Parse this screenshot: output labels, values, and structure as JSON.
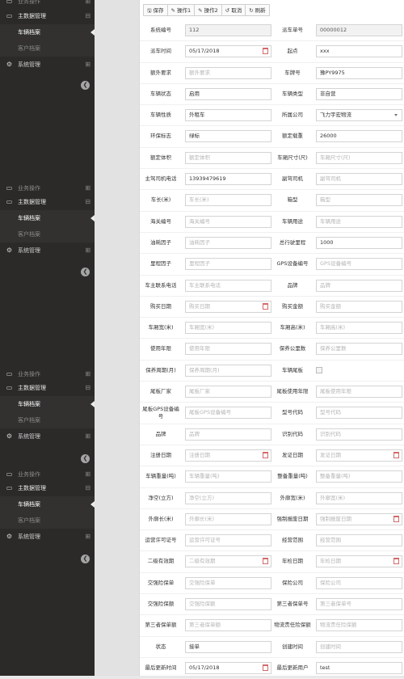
{
  "sidebar": {
    "ops_label": "业务操作",
    "master_label": "主数据管理",
    "vehicle_file": "车辆档案",
    "customer_file": "客户档案",
    "system_label": "系统管理"
  },
  "toolbar": {
    "save": "保存",
    "op1": "操作1",
    "op2": "操作2",
    "cancel": "取消",
    "refresh": "刷新"
  },
  "form": {
    "rows": [
      {
        "l": "系统编号",
        "lv": "112",
        "lt": "ro",
        "r": "派车单号",
        "rv": "00000012",
        "rt": "ro"
      },
      {
        "l": "派车时间",
        "lv": "05/17/2018",
        "lt": "date",
        "r": "起点",
        "rv": "xxx",
        "rt": "val"
      },
      {
        "l": "额外要求",
        "lv": "额外要求",
        "lt": "ph",
        "r": "车牌号",
        "rv": "豫PY9975",
        "rt": "val"
      },
      {
        "l": "车辆状态",
        "lv": "启用",
        "lt": "val",
        "r": "车辆类型",
        "rv": "非自营",
        "rt": "val"
      },
      {
        "l": "车辆性质",
        "lv": "外租车",
        "lt": "val",
        "r": "所属公司",
        "rv": "飞力宇宏物流",
        "rt": "select"
      },
      {
        "l": "环保标志",
        "lv": "绿标",
        "lt": "val",
        "r": "额定载重",
        "rv": "26000",
        "rt": "val"
      },
      {
        "l": "额定体积",
        "lv": "额定体积",
        "lt": "ph",
        "r": "车厢尺寸(尺)",
        "rv": "车厢尺寸(尺)",
        "rt": "ph"
      },
      {
        "l": "主驾司机电话",
        "lv": "13939479619",
        "lt": "val",
        "r": "副驾司机",
        "rv": "副驾司机",
        "rt": "ph"
      },
      {
        "l": "车长(米)",
        "lv": "车长(米)",
        "lt": "ph",
        "r": "箱型",
        "rv": "箱型",
        "rt": "ph"
      },
      {
        "l": "海关编号",
        "lv": "海关编号",
        "lt": "ph",
        "r": "车辆用途",
        "rv": "车辆用途",
        "rt": "ph"
      },
      {
        "l": "油耗因子",
        "lv": "油耗因子",
        "lt": "ph",
        "r": "总行驶里程",
        "rv": "1000",
        "rt": "val"
      },
      {
        "l": "里程因子",
        "lv": "里程因子",
        "lt": "ph",
        "r": "GPS设备编号",
        "rv": "GPS设备编号",
        "rt": "ph"
      },
      {
        "l": "车主联系电话",
        "lv": "车主联系电话",
        "lt": "ph",
        "r": "品牌",
        "rv": "品牌",
        "rt": "ph"
      },
      {
        "l": "购买日期",
        "lv": "购买日期",
        "lt": "phdate",
        "r": "购买金额",
        "rv": "购买金额",
        "rt": "ph"
      },
      {
        "l": "车厢宽(米)",
        "lv": "车厢宽(米)",
        "lt": "ph",
        "r": "车厢高(米)",
        "rv": "车厢高(米)",
        "rt": "ph"
      },
      {
        "l": "使用年限",
        "lv": "使用年限",
        "lt": "ph",
        "r": "保养公里数",
        "rv": "保养公里数",
        "rt": "ph"
      },
      {
        "l": "保养周期(月)",
        "lv": "保养周期(月)",
        "lt": "ph",
        "r": "车辆尾板",
        "rv": "",
        "rt": "check"
      },
      {
        "l": "尾板厂家",
        "lv": "尾板厂家",
        "lt": "ph",
        "r": "尾板使用年限",
        "rv": "尾板使用年限",
        "rt": "ph"
      },
      {
        "l": "尾板GPS设备编号",
        "lv": "尾板GPS设备编号",
        "lt": "ph",
        "r": "型号代码",
        "rv": "型号代码",
        "rt": "ph"
      },
      {
        "l": "品牌",
        "lv": "品牌",
        "lt": "ph",
        "r": "识别代码",
        "rv": "识别代码",
        "rt": "ph"
      },
      {
        "l": "注册日期",
        "lv": "注册日期",
        "lt": "phdate",
        "r": "发证日期",
        "rv": "发证日期",
        "rt": "phdate"
      },
      {
        "l": "车辆重量(吨)",
        "lv": "车辆重量(吨)",
        "lt": "ph",
        "r": "整备重量(吨)",
        "rv": "整备重量(吨)",
        "rt": "ph"
      },
      {
        "l": "净空(立方)",
        "lv": "净空(立方)",
        "lt": "ph",
        "r": "外廓宽(米)",
        "rv": "外廓宽(米)",
        "rt": "ph"
      },
      {
        "l": "外廓长(米)",
        "lv": "外廓长(米)",
        "lt": "ph",
        "r": "强制报废日期",
        "rv": "强制报废日期",
        "rt": "phdate"
      },
      {
        "l": "运营许可证号",
        "lv": "运营许可证号",
        "lt": "ph",
        "r": "经营范围",
        "rv": "经营范围",
        "rt": "ph"
      },
      {
        "l": "二级有效期",
        "lv": "二级有效期",
        "lt": "phdate",
        "r": "年检日期",
        "rv": "年检日期",
        "rt": "phdate"
      },
      {
        "l": "交强险保单",
        "lv": "交强险保单",
        "lt": "ph",
        "r": "保险公司",
        "rv": "保险公司",
        "rt": "ph"
      },
      {
        "l": "交强险保额",
        "lv": "交强险保额",
        "lt": "ph",
        "r": "第三者保单号",
        "rv": "第三者保单号",
        "rt": "ph"
      },
      {
        "l": "第三者保单额",
        "lv": "第三者保单额",
        "lt": "ph",
        "r": "物流责任险保额",
        "rv": "物流责任险保额",
        "rt": "ph"
      },
      {
        "l": "状态",
        "lv": "接单",
        "lt": "val",
        "r": "创建时间",
        "rv": "创建时间",
        "rt": "ph"
      },
      {
        "l": "最后更新时间",
        "lv": "05/17/2018",
        "lt": "date",
        "r": "最后更新用户",
        "rv": "test",
        "rt": "val"
      }
    ]
  }
}
